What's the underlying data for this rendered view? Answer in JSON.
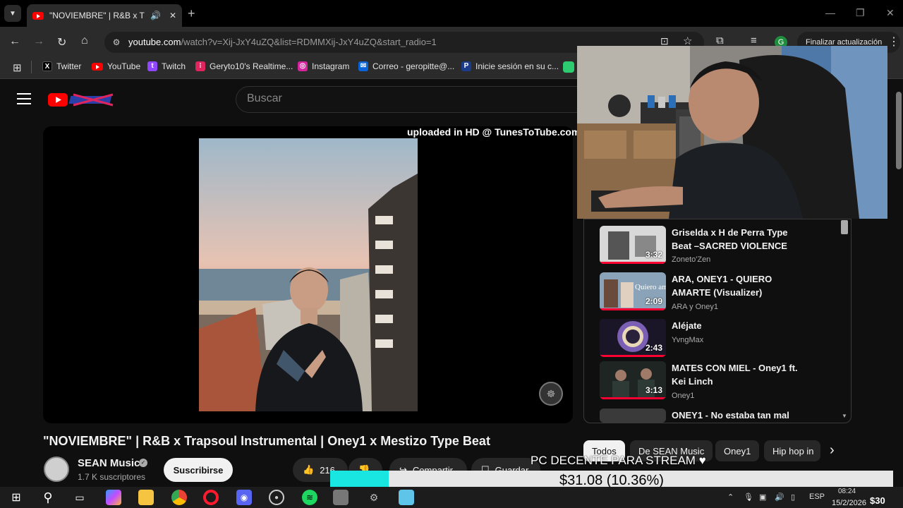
{
  "browser": {
    "tab_title": "\"NOVIEMBRE\" | R&B x Trapsoul",
    "url_domain": "youtube.com",
    "url_path": "/watch?v=Xij-JxY4uZQ&list=RDMMXij-JxY4uZQ&start_radio=1",
    "update_button": "Finalizar actualización",
    "profile_initial": "G",
    "bookmarks": [
      {
        "label": "Twitter",
        "icon": "x-icon"
      },
      {
        "label": "YouTube",
        "icon": "youtube-icon"
      },
      {
        "label": "Twitch",
        "icon": "twitch-icon"
      },
      {
        "label": "Geryto10's Realtime...",
        "icon": "realtime-icon"
      },
      {
        "label": "Instagram",
        "icon": "instagram-icon"
      },
      {
        "label": "Correo - geropitte@...",
        "icon": "mail-icon"
      },
      {
        "label": "Inicie sesión en su c...",
        "icon": "paypal-icon"
      }
    ]
  },
  "youtube": {
    "search_placeholder": "Buscar",
    "video": {
      "watermark": "uploaded in HD @ TunesToTube.com",
      "title": "\"NOVIEMBRE\" | R&B x Trapsoul Instrumental | Oney1 x Mestizo Type Beat",
      "channel": "SEAN Music",
      "subscribers": "1.7 K suscriptores",
      "subscribe_label": "Suscribirse",
      "likes": "216",
      "share_label": "Compartir",
      "save_label": "Guardar"
    },
    "recommendations": [
      {
        "title": "Griselda x H de Perra Type Beat –SACRED VIOLENCE",
        "channel": "Zoneto'Zen",
        "duration": "3:32"
      },
      {
        "title": "ARA, ONEY1 - QUIERO AMARTE (Visualizer)",
        "channel": "ARA y Oney1",
        "duration": "2:09",
        "thumb_text": "Quiero amarte"
      },
      {
        "title": "Aléjate",
        "channel": "YvngMax",
        "duration": "2:43"
      },
      {
        "title": "MATES CON MIEL - Oney1 ft. Kei Linch",
        "channel": "Oney1",
        "duration": "3:13"
      },
      {
        "title": "ONEY1 - No estaba tan mal",
        "channel": "",
        "duration": ""
      }
    ],
    "chips": [
      "Todos",
      "De SEAN Music",
      "Oney1",
      "Hip hop in"
    ]
  },
  "stream": {
    "goal_label": "PC DECENTE PARA STREAM ♥",
    "progress_text": "$31.08 (10.36%)",
    "progress_fraction": 0.1036
  },
  "taskbar": {
    "language": "ESP",
    "time": "08:24",
    "date": "15/2/2026",
    "tray_amount": "$30"
  },
  "colors": {
    "youtube_red": "#ff0000",
    "progress_fill": "#19e6e0",
    "page_background": "#0f0f0f"
  }
}
